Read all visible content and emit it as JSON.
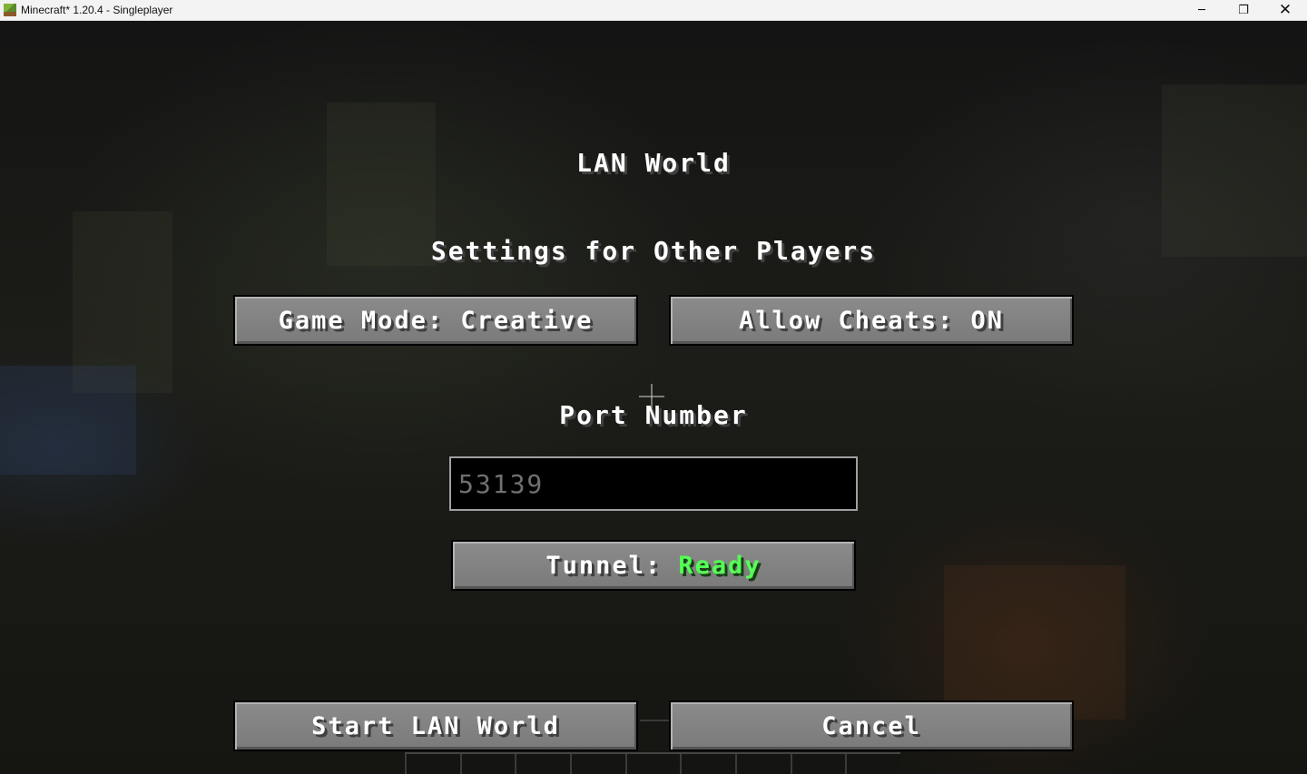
{
  "window": {
    "title": "Minecraft* 1.20.4 - Singleplayer",
    "controls": {
      "minimize": "─",
      "maximize": "❐",
      "close": "✕"
    }
  },
  "screen": {
    "title": "LAN World",
    "subtitle": "Settings for Other Players",
    "port_label": "Port Number"
  },
  "buttons": {
    "game_mode": "Game Mode: Creative",
    "allow_cheats": "Allow Cheats: ON",
    "tunnel_label": "Tunnel: ",
    "tunnel_status": "Ready",
    "start": "Start LAN World",
    "cancel": "Cancel"
  },
  "port_input": {
    "value": "",
    "placeholder": "53139"
  },
  "colors": {
    "button_face": "#8b8b8b",
    "text": "#ffffff",
    "status_ready": "#55ff55"
  }
}
